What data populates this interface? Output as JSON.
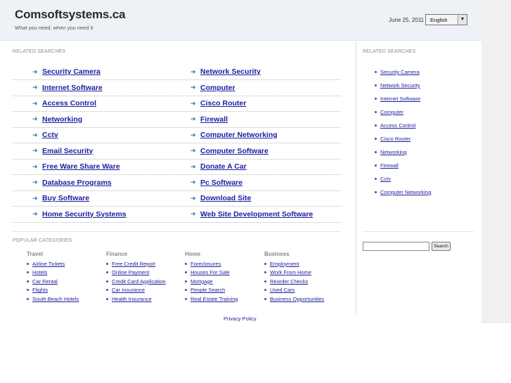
{
  "header": {
    "title": "Comsoftsystems.ca",
    "tagline": "What you need, when you need it",
    "date": "June 25, 2011",
    "language": "English"
  },
  "related_searches": {
    "label": "RELATED SEARCHES",
    "left": [
      "Security Camera",
      "Internet Software",
      "Access Control",
      "Networking",
      "Cctv",
      "Email Security",
      "Free Ware Share Ware",
      "Database Programs",
      "Buy Software",
      "Home Security Systems"
    ],
    "right": [
      "Network Security",
      "Computer",
      "Cisco Router",
      "Firewall",
      "Computer Networking",
      "Computer Software",
      "Donate A Car",
      "Pc Software",
      "Download Site",
      "Web Site Development Software"
    ]
  },
  "side_searches": {
    "label": "RELATED SEARCHES",
    "items": [
      "Security Camera",
      "Network Security",
      "Internet Software",
      "Computer",
      "Access Control",
      "Cisco Router",
      "Networking",
      "Firewall",
      "Cctv",
      "Computer Networking"
    ]
  },
  "search": {
    "button_label": "Search"
  },
  "popular": {
    "label": "POPULAR CATEGORIES",
    "columns": [
      {
        "heading": "Travel",
        "items": [
          "Airline Tickets",
          "Hotels",
          "Car Rental",
          "Flights",
          "South Beach Hotels"
        ]
      },
      {
        "heading": "Finance",
        "items": [
          "Free Credit Report",
          "Online Payment",
          "Credit Card Application",
          "Car Insurance",
          "Health Insurance"
        ]
      },
      {
        "heading": "Home",
        "items": [
          "Foreclosures",
          "Houses For Sale",
          "Mortgage",
          "People Search",
          "Real Estate Training"
        ]
      },
      {
        "heading": "Business",
        "items": [
          "Employment",
          "Work From Home",
          "Reorder Checks",
          "Used Cars",
          "Business Opportunities"
        ]
      }
    ]
  },
  "footer": {
    "privacy": "Privacy Policy"
  },
  "colors": {
    "link": "#1d1d9e",
    "arrow": "#2a7a9e",
    "header_bg": "#eef2f6"
  }
}
